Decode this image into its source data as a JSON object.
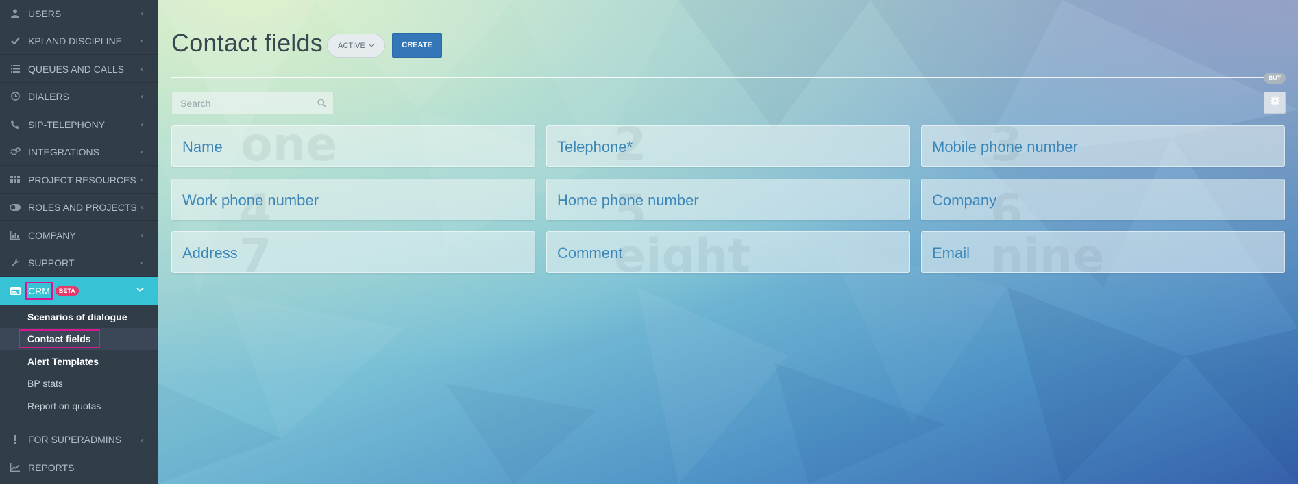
{
  "sidebar": {
    "items": [
      {
        "label": "USERS",
        "icon": "user-icon"
      },
      {
        "label": "KPI AND DISCIPLINE",
        "icon": "check-icon"
      },
      {
        "label": "QUEUES AND CALLS",
        "icon": "list-icon"
      },
      {
        "label": "DIALERS",
        "icon": "clock-icon"
      },
      {
        "label": "SIP-TELEPHONY",
        "icon": "phone-icon"
      },
      {
        "label": "INTEGRATIONS",
        "icon": "cogs-icon"
      },
      {
        "label": "PROJECT RESOURCES",
        "icon": "grid-icon"
      },
      {
        "label": "ROLES AND PROJECTS",
        "icon": "toggle-icon"
      },
      {
        "label": "COMPANY",
        "icon": "bar-chart-icon"
      },
      {
        "label": "SUPPORT",
        "icon": "wrench-icon"
      },
      {
        "label": "CRM",
        "icon": "crm-icon",
        "badge": "BETA"
      },
      {
        "label": "FOR SUPERADMINS",
        "icon": "exclamation-icon"
      },
      {
        "label": "REPORTS",
        "icon": "line-chart-icon"
      }
    ],
    "crm_submenu": [
      {
        "label": "Scenarios of dialogue"
      },
      {
        "label": "Contact fields"
      },
      {
        "label": "Alert Templates"
      },
      {
        "label": "BP stats"
      },
      {
        "label": "Report on quotas"
      }
    ]
  },
  "header": {
    "title": "Contact fields",
    "status_filter": "ACTIVE",
    "create_label": "CREATE",
    "but_badge": "BUT"
  },
  "search": {
    "placeholder": "Search"
  },
  "fields": [
    {
      "label": "Name",
      "watermark": "one"
    },
    {
      "label": "Telephone*",
      "watermark": "2"
    },
    {
      "label": "Mobile phone number",
      "watermark": "3"
    },
    {
      "label": "Work phone number",
      "watermark": "4"
    },
    {
      "label": "Home phone number",
      "watermark": "5"
    },
    {
      "label": "Company",
      "watermark": "6"
    },
    {
      "label": "Address",
      "watermark": "7"
    },
    {
      "label": "Comment",
      "watermark": "eight"
    },
    {
      "label": "Email",
      "watermark": "nine"
    }
  ],
  "colors": {
    "sidebar_bg": "#323d4a",
    "active_item": "#36c3d6",
    "highlight": "#d6178f",
    "beta_badge": "#e8396a",
    "create_button": "#3477b8",
    "field_text": "#3d86b8"
  }
}
